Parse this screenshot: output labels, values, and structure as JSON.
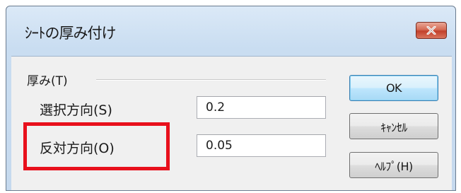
{
  "window": {
    "title": "ｼｰﾄの厚み付け"
  },
  "group": {
    "label": "厚み(T)"
  },
  "fields": {
    "selection_direction": {
      "label": "選択方向(S)",
      "value": "0.2"
    },
    "opposite_direction": {
      "label": "反対方向(O)",
      "value": "0.05"
    }
  },
  "buttons": {
    "ok": "OK",
    "cancel": "ｷｬﾝｾﾙ",
    "help": "ﾍﾙﾌﾟ(H)"
  },
  "colors": {
    "highlight": "#e8101c",
    "close_button": "#c2402b",
    "default_button_border": "#3c7fb1"
  }
}
